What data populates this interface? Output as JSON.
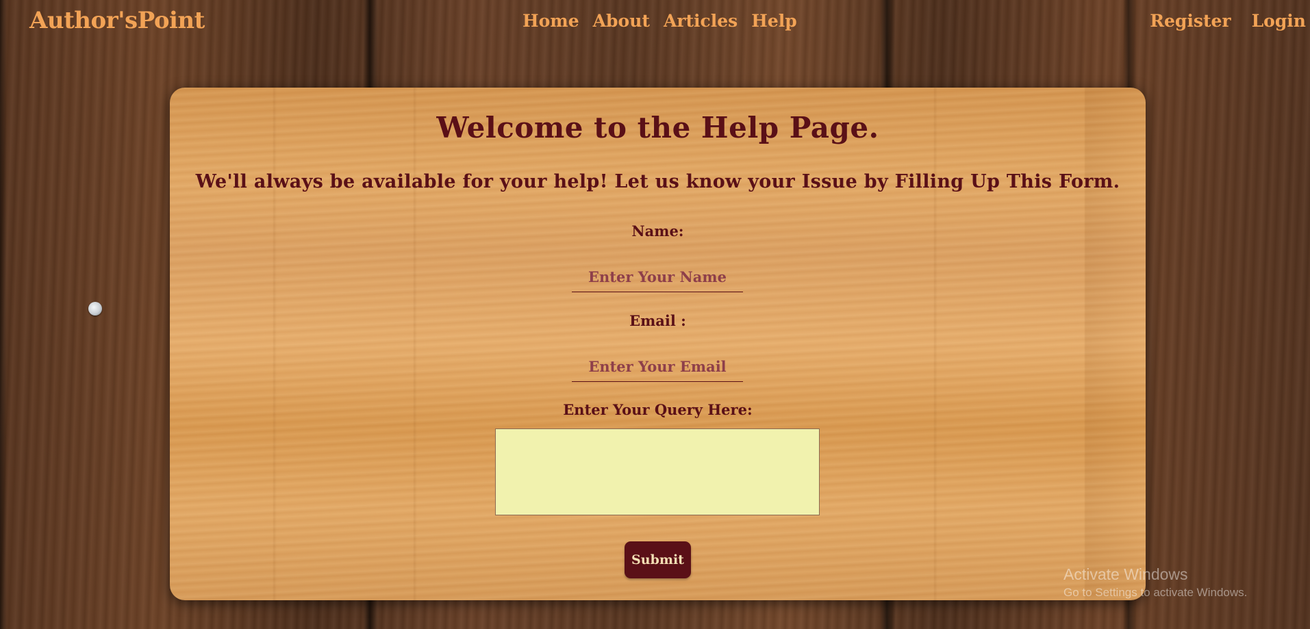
{
  "navbar": {
    "brand": "Author'sPoint",
    "links": [
      {
        "label": "Home"
      },
      {
        "label": "About"
      },
      {
        "label": "Articles"
      },
      {
        "label": "Help"
      }
    ],
    "auth": {
      "register": "Register",
      "login": "Login"
    }
  },
  "help_form": {
    "title": "Welcome to the Help Page.",
    "subtitle": "We'll always be available for your help! Let us know your Issue by Filling Up This Form.",
    "name": {
      "label": "Name:",
      "placeholder": "Enter Your Name",
      "value": ""
    },
    "email": {
      "label": "Email :",
      "placeholder": "Enter Your Email",
      "value": ""
    },
    "query": {
      "label": "Enter Your Query Here:",
      "value": ""
    },
    "submit_label": "Submit"
  },
  "os_watermark": {
    "title": "Activate Windows",
    "subtitle": "Go to Settings to activate Windows."
  },
  "colors": {
    "accent_orange": "#f2a356",
    "maroon": "#5a1017",
    "textarea_bg": "#f1f2ae"
  }
}
